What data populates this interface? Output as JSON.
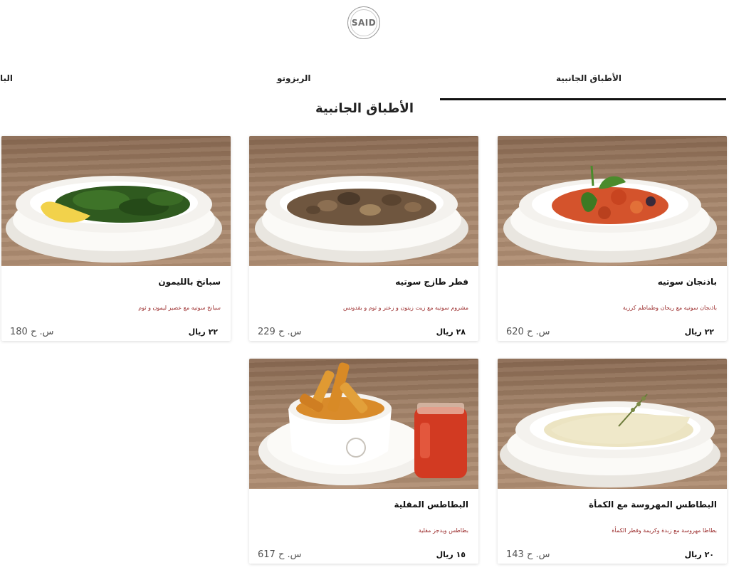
{
  "logo": {
    "text": "SAID"
  },
  "tabs": [
    {
      "label": "الأطباق الجانبية",
      "active": true
    },
    {
      "label": "الريزوتو",
      "active": false
    },
    {
      "label": "البا",
      "active": false
    }
  ],
  "section_title": "الأطباق الجانبية",
  "items": [
    {
      "name": "باذنجان سوتيه",
      "description": "باذنجان سوتيه مع ريحان وطماطم كرزية",
      "price_ar": "٢٢ ريال",
      "price_alt": "620 س. ح",
      "icon": "sauteed-eggplant-dish"
    },
    {
      "name": "فطر طازج سوتيه",
      "description": "مشروم سوتيه مع زيت زيتون و زعتر و ثوم و بقدونس",
      "price_ar": "٢٨ ريال",
      "price_alt": "229 س. ح",
      "icon": "sauteed-mushroom-dish"
    },
    {
      "name": "سبانخ بالليمون",
      "description": "سبانخ سوتيه مع عصير ليمون و ثوم",
      "price_ar": "٢٢ ريال",
      "price_alt": "180 س. ح",
      "icon": "spinach-lemon-dish"
    },
    {
      "name": "البطاطس المهروسة مع الكمأة",
      "description": "بطاطا مهروسة مع زبدة وكريمة وقطر الكمأة",
      "price_ar": "٢٠ ريال",
      "price_alt": "143 س. ح",
      "icon": "mashed-potato-dish"
    },
    {
      "name": "البطاطس المقلية",
      "description": "بطاطس ويدجز مقلية",
      "price_ar": "١٥ ريال",
      "price_alt": "617 س. ح",
      "icon": "fried-potatoes-dish"
    }
  ],
  "colors": {
    "accent_underline": "#111111",
    "description_text": "#9b2c2c",
    "wood": "#a5856b"
  }
}
